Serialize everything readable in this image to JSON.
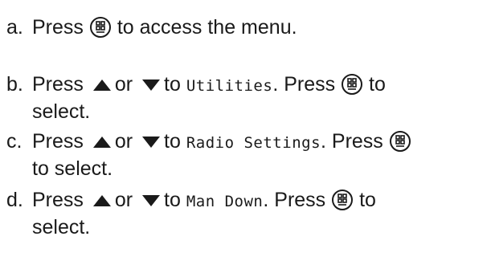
{
  "steps": [
    {
      "letter": "a.",
      "parts": {
        "press": "Press",
        "after_menu": "to access the menu."
      }
    },
    {
      "letter": "b.",
      "parts": {
        "press": "Press",
        "or": "or",
        "to": "to",
        "menu_item": "Utilities",
        "press_again": ". Press",
        "to_end": "to",
        "select": "select."
      }
    },
    {
      "letter": "c.",
      "parts": {
        "press": "Press",
        "or": "or",
        "to": "to",
        "menu_item": "Radio Settings",
        "press_again": ". Press",
        "select": "to select."
      }
    },
    {
      "letter": "d.",
      "parts": {
        "press": "Press",
        "or": "or",
        "to": "to",
        "menu_item": "Man Down",
        "press_again": ". Press",
        "to_end": "to",
        "select": "select."
      }
    }
  ],
  "icons": {
    "menu_ok": "menu-ok-button-icon",
    "up": "up-arrow-icon",
    "down": "down-arrow-icon"
  },
  "colors": {
    "text": "#1a1a1a",
    "icon": "#1a1a1a"
  }
}
